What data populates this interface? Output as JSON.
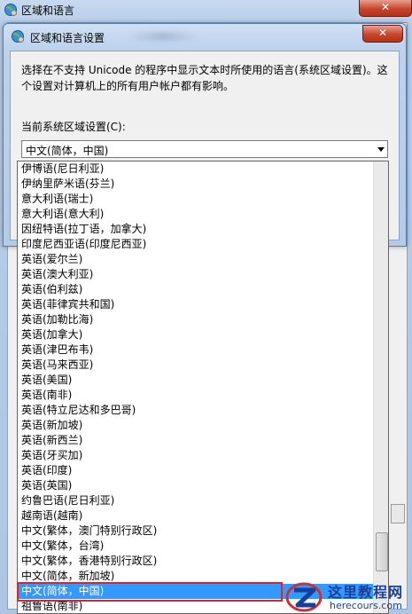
{
  "outer_window": {
    "title": "区域和语言",
    "close_glyph": "✕"
  },
  "dialog": {
    "title": "区域和语言设置",
    "close_glyph": "✕",
    "description": "选择在不支持 Unicode 的程序中显示文本时所使用的语言(系统区域设置)。这个设置对计算机上的所有用户帐户都有影响。",
    "locale_label": "当前系统区域设置(C):",
    "locale_value": "中文(简体，中国)"
  },
  "dropdown": {
    "selected_index": 28,
    "items": [
      "伊博语(尼日利亚)",
      "伊纳里萨米语(芬兰)",
      "意大利语(瑞士)",
      "意大利语(意大利)",
      "因纽特语(拉丁语，加拿大)",
      "印度尼西亚语(印度尼西亚)",
      "英语(爱尔兰)",
      "英语(澳大利亚)",
      "英语(伯利兹)",
      "英语(菲律宾共和国)",
      "英语(加勒比海)",
      "英语(加拿大)",
      "英语(津巴布韦)",
      "英语(马来西亚)",
      "英语(美国)",
      "英语(南非)",
      "英语(特立尼达和多巴哥)",
      "英语(新加坡)",
      "英语(新西兰)",
      "英语(牙买加)",
      "英语(印度)",
      "英语(英国)",
      "约鲁巴语(尼日利亚)",
      "越南语(越南)",
      "中文(繁体，澳门特别行政区)",
      "中文(繁体，台湾)",
      "中文(繁体，香港特别行政区)",
      "中文(简体，新加坡)",
      "中文(简体，中国)",
      "祖鲁语(南非)"
    ]
  },
  "watermark": {
    "name": "这里教程网",
    "url": "herecours.com"
  },
  "icons": {
    "outer": "globe-settings-icon",
    "dialog": "globe-settings-icon",
    "logo": "herecours-logo-icon"
  },
  "colors": {
    "selection": "#3399ff",
    "highlight": "#e0241f",
    "close_button": "#c8452c",
    "watermark": "#1a3f9a"
  }
}
